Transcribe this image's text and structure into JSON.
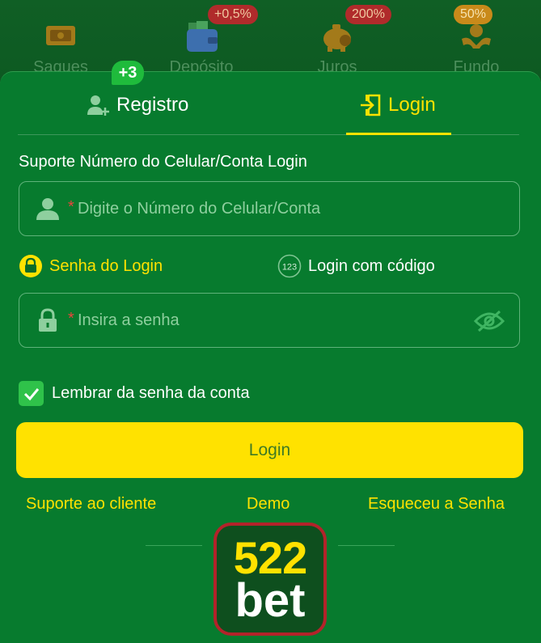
{
  "topbar": {
    "items": [
      {
        "label": "Saques",
        "icon": "ticket-icon",
        "badge": ""
      },
      {
        "label": "Depósito",
        "icon": "wallet-icon",
        "badge": "+0,5%"
      },
      {
        "label": "Juros",
        "icon": "piggy-bank-icon",
        "badge": "200%"
      },
      {
        "label": "Fundo",
        "icon": "hands-coin-icon",
        "badge": "50%"
      }
    ]
  },
  "tabs": {
    "register": {
      "label": "Registro",
      "badge": "+3",
      "icon": "add-user-icon"
    },
    "login": {
      "label": "Login",
      "icon": "login-door-icon",
      "active": true
    }
  },
  "form": {
    "support_label": "Suporte Número do Celular/Conta Login",
    "account_field": {
      "required_mark": "*",
      "placeholder": "Digite o Número do Celular/Conta",
      "value": ""
    },
    "login_modes": {
      "password": {
        "label": "Senha do Login",
        "icon": "lock-icon",
        "active": true
      },
      "code": {
        "label": "Login com código",
        "icon": "code-123-icon",
        "icon_text": "123"
      }
    },
    "password_field": {
      "required_mark": "*",
      "placeholder": "Insira a senha",
      "value": ""
    },
    "remember": {
      "label": "Lembrar da senha da conta",
      "checked": true
    },
    "submit_label": "Login"
  },
  "footer": {
    "support": "Suporte ao cliente",
    "demo": "Demo",
    "forgot": "Esqueceu a Senha"
  },
  "logo": {
    "number": "522",
    "word": "bet"
  },
  "colors": {
    "accent": "#ffe200",
    "card_bg": "#077b2e",
    "page_bg": "#0b5a1f",
    "badge_red": "#b02b2b",
    "checkbox_green": "#2fc24a"
  }
}
